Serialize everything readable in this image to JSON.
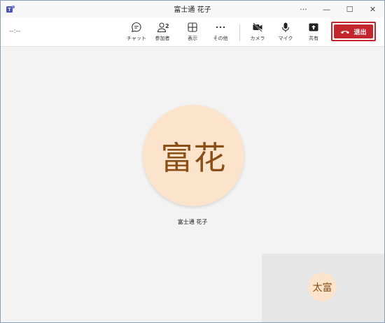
{
  "window": {
    "title": "富士通 花子",
    "controls": {
      "more": "···",
      "minimize": "—",
      "maximize": "☐",
      "close": "✕"
    }
  },
  "toolbar": {
    "timer": "--:--",
    "chat_label": "チャット",
    "participants_label": "参加者",
    "participants_count": "2",
    "view_label": "表示",
    "more_label": "その他",
    "camera_label": "カメラ",
    "mic_label": "マイク",
    "share_label": "共有",
    "leave_label": "退出"
  },
  "stage": {
    "main_initials": "富花",
    "main_name": "富士通 花子",
    "self_initials": "太富"
  },
  "colors": {
    "leave": "#c4262e",
    "avatar_bg": "#fce4cc",
    "avatar_text": "#8a4f17"
  },
  "icons": [
    "teams-icon",
    "chat-icon",
    "people-icon",
    "grid-view-icon",
    "more-icon",
    "camera-off-icon",
    "mic-icon",
    "share-icon",
    "phone-hangup-icon"
  ]
}
